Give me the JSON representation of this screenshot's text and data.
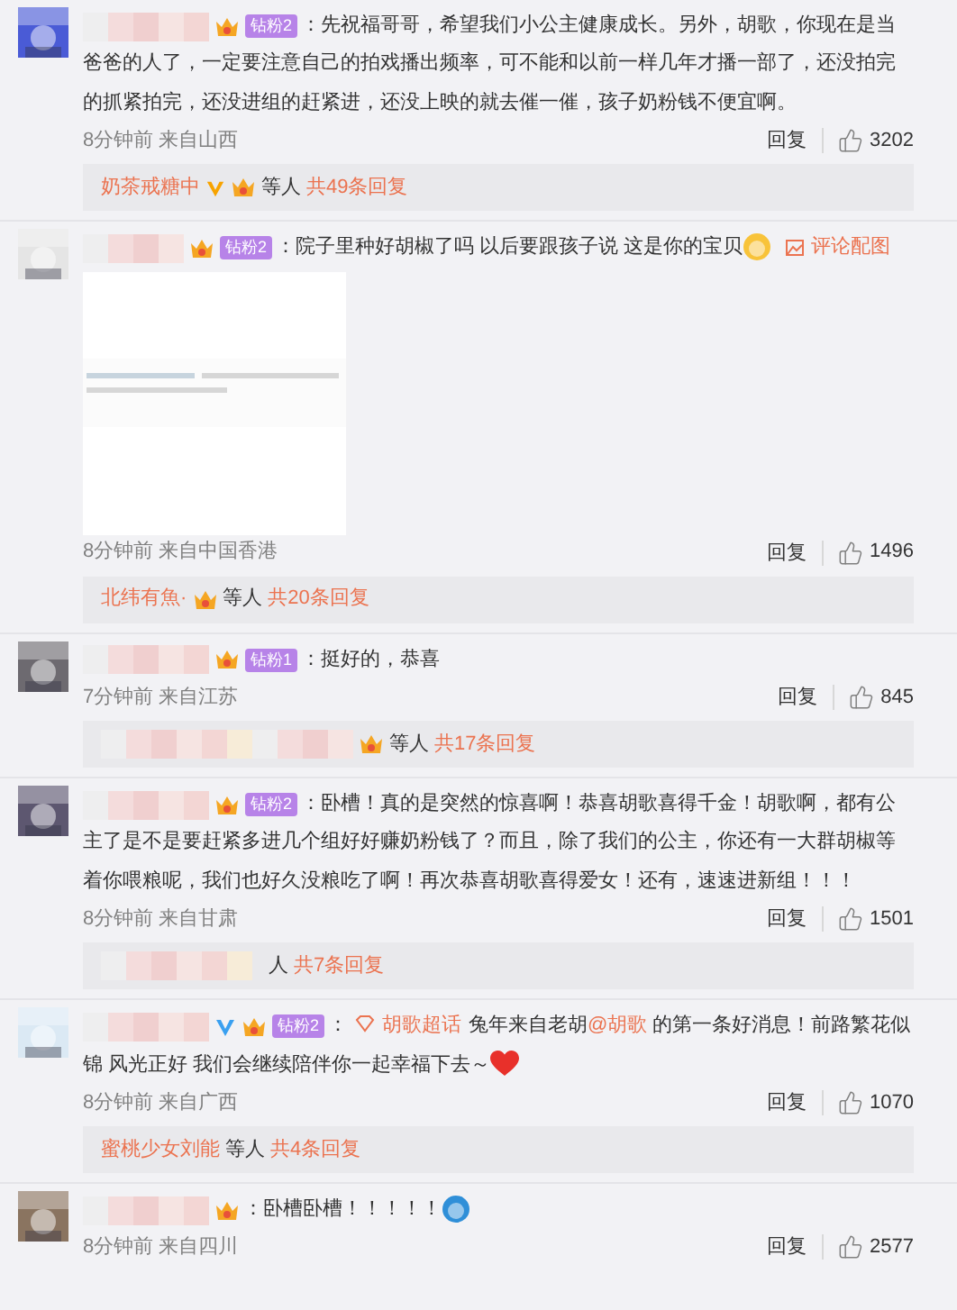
{
  "comments": [
    {
      "verified": false,
      "badge": {
        "crown": true,
        "level": "钻粉2"
      },
      "body": [
        {
          "kind": "text",
          "text": "：先祝福哥哥，希望我们小公主健康成长。另外，胡歌，你现在是当爸爸的人了，一定要注意自己的拍戏播出频率，可不能和以前一样几年才播一部了，还没拍完的抓紧拍完，还没进组的赶紧进，还没上映的就去催一催，孩子奶粉钱不便宜啊。"
        }
      ],
      "meta": "8分钟前 来自山西",
      "reply": "回复",
      "likes": "3202",
      "thread": {
        "user": {
          "name": "奶茶戒糖中",
          "verified": true,
          "crown": true
        },
        "more": "等人",
        "count": "共49条回复"
      }
    },
    {
      "verified": false,
      "badge": {
        "crown": true,
        "level": "钻粉2"
      },
      "body": [
        {
          "kind": "text",
          "text": "：院子里种好胡椒了吗 以后要跟孩子说 这是你的宝贝"
        },
        {
          "kind": "emoji",
          "color": "#f8c33a"
        }
      ],
      "image_link": "评论配图",
      "meta": "8分钟前 来自中国香港",
      "reply": "回复",
      "likes": "1496",
      "thread": {
        "user": {
          "name": "北纬有魚·",
          "verified": false,
          "crown": true
        },
        "more": "等人",
        "count": "共20条回复"
      }
    },
    {
      "verified": false,
      "badge": {
        "crown": true,
        "level": "钻粉1"
      },
      "body": [
        {
          "kind": "text",
          "text": "：挺好的，恭喜"
        }
      ],
      "meta": "7分钟前 来自江苏",
      "reply": "回复",
      "likes": "845",
      "thread": {
        "user": {
          "verified": false,
          "crown": true
        },
        "more": "等人",
        "count": "共17条回复"
      }
    },
    {
      "verified": false,
      "badge": {
        "crown": true,
        "level": "钻粉2"
      },
      "body": [
        {
          "kind": "text",
          "text": "：卧槽！真的是突然的惊喜啊！恭喜胡歌喜得千金！胡歌啊，都有公主了是不是要赶紧多进几个组好好赚奶粉钱了？而且，除了我们的公主，你还有一大群胡椒等着你喂粮呢，我们也好久没粮吃了啊！再次恭喜胡歌喜得爱女！还有，速速进新组！！！"
        }
      ],
      "meta": "8分钟前 来自甘肃",
      "reply": "回复",
      "likes": "1501",
      "thread": {
        "user": {
          "verified": false,
          "crown": false
        },
        "more": "人",
        "count": "共7条回复"
      }
    },
    {
      "verified": true,
      "badge": {
        "crown": true,
        "level": "钻粉2"
      },
      "body": [
        {
          "kind": "text",
          "text": "："
        },
        {
          "kind": "topic",
          "text": "胡歌超话"
        },
        {
          "kind": "text",
          "text": "兔年来自老胡"
        },
        {
          "kind": "mention",
          "text": "@胡歌"
        },
        {
          "kind": "text",
          "text": " 的第一条好消息！前路繁花似锦 风光正好 我们会继续陪伴你一起幸福下去～"
        },
        {
          "kind": "heart"
        }
      ],
      "meta": "8分钟前 来自广西",
      "reply": "回复",
      "likes": "1070",
      "thread": {
        "user": {
          "name": "蜜桃少女刘能",
          "verified": false,
          "crown": false
        },
        "more": "等人",
        "count": "共4条回复"
      }
    },
    {
      "verified": false,
      "badge": {
        "crown": true
      },
      "body": [
        {
          "kind": "text",
          "text": "：卧槽卧槽！！！！！"
        },
        {
          "kind": "emoji",
          "color": "#2f8fd8"
        }
      ],
      "meta": "8分钟前 来自四川",
      "reply": "回复",
      "likes": "2577"
    }
  ]
}
